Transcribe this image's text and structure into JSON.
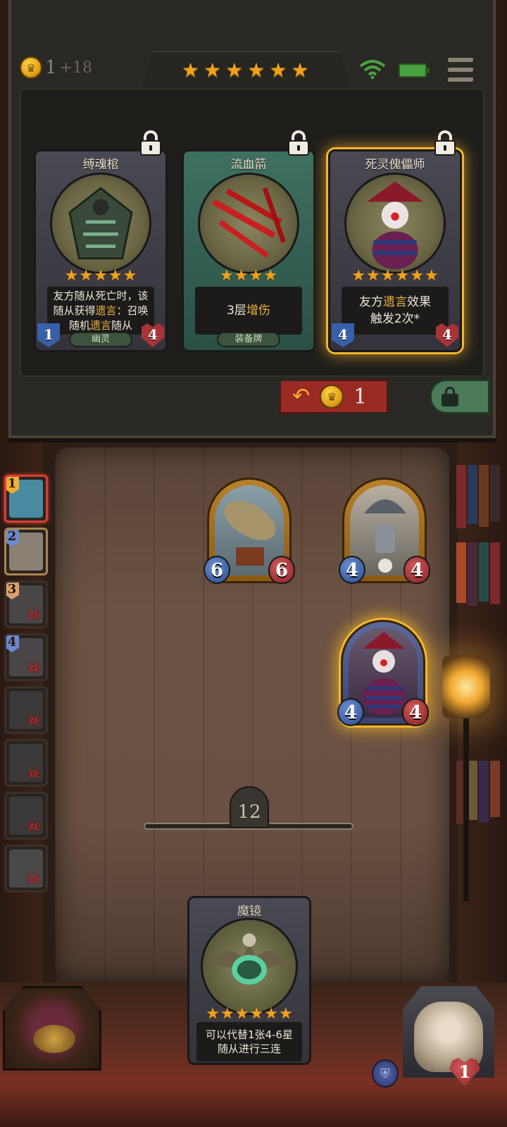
{
  "top_bar": {
    "gold": "1",
    "gold_income": "+18",
    "tier_stars": 6
  },
  "shop": {
    "cards": [
      {
        "name": "缚魂棺",
        "stars": 5,
        "desc_parts": [
          "友方随从死亡时，该随从获得",
          "遗言",
          "：召唤随机",
          "遗言",
          "随从"
        ],
        "tag": "幽灵",
        "attack": "1",
        "health": "4",
        "locked": true,
        "frame": "gray"
      },
      {
        "name": "流血箭",
        "stars": 4,
        "desc_parts": [
          "3层",
          "增伤"
        ],
        "tag": "装备牌",
        "attack": "",
        "health": "",
        "locked": true,
        "frame": "teal"
      },
      {
        "name": "死灵傀儡师",
        "stars": 6,
        "desc_parts": [
          "友方",
          "遗言",
          "效果",
          "触发2次*"
        ],
        "tag": "",
        "attack": "4",
        "health": "4",
        "locked": true,
        "frame": "gray",
        "selected": true
      }
    ],
    "refresh_cost": "1"
  },
  "roster": [
    {
      "rank": "1",
      "state": "current",
      "color": "#f0b030",
      "eliminated": false
    },
    {
      "rank": "2",
      "state": "next",
      "color": "#6a8ad0",
      "eliminated": false
    },
    {
      "rank": "3",
      "state": "",
      "color": "#d8a070",
      "eliminated": true
    },
    {
      "rank": "4",
      "state": "",
      "color": "#6a8ad0",
      "eliminated": true
    },
    {
      "rank": "",
      "state": "",
      "color": "",
      "eliminated": true
    },
    {
      "rank": "",
      "state": "",
      "color": "",
      "eliminated": true
    },
    {
      "rank": "",
      "state": "",
      "color": "",
      "eliminated": true
    },
    {
      "rank": "",
      "state": "",
      "color": "",
      "eliminated": true
    }
  ],
  "board": [
    {
      "name": "airship-minion",
      "attack": "6",
      "health": "6"
    },
    {
      "name": "bell-robot-minion",
      "attack": "4",
      "health": "4"
    },
    {
      "name": "puppeteer-minion",
      "attack": "4",
      "health": "4"
    }
  ],
  "timer": "12",
  "hand_card": {
    "name": "魔镜",
    "stars": 6,
    "desc_line1": "可以代替1张4-6星",
    "desc_line2": "随从进行三连"
  },
  "hero": {
    "health": "1"
  },
  "colors": {
    "gold_star": "#f0a21e",
    "keyword": "#e8b040",
    "attack_blue": "#3860a8",
    "health_red": "#a83438"
  }
}
